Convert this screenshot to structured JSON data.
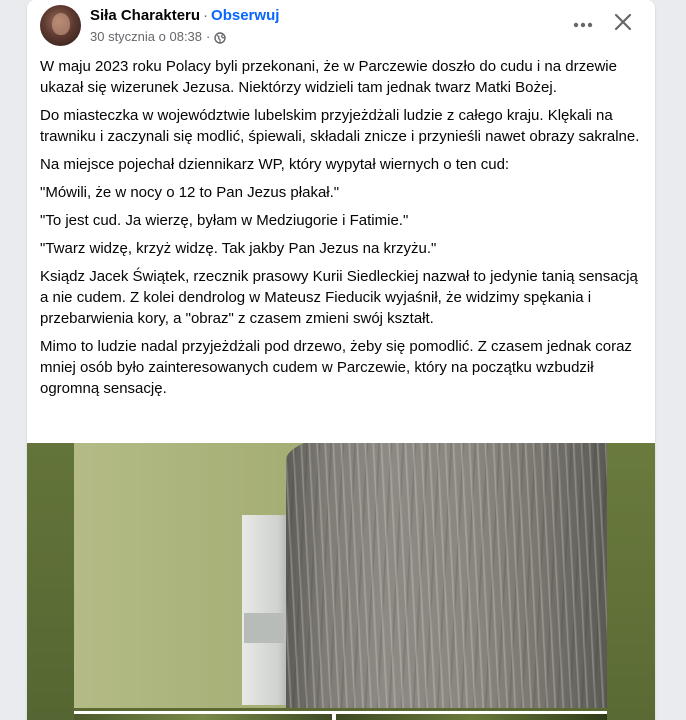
{
  "post": {
    "author": "Siła Charakteru",
    "separator": "·",
    "follow_label": "Obserwuj",
    "timestamp": "30 stycznia o 08:38",
    "timestamp_separator": "·",
    "privacy_icon": "globe-icon",
    "more_icon": "more-horizontal-icon",
    "close_icon": "close-icon",
    "paragraphs": [
      "W maju 2023 roku Polacy byli przekonani, że w Parczewie doszło do cudu i na drzewie ukazał się wizerunek Jezusa. Niektórzy widzieli tam jednak twarz Matki Bożej.",
      "Do miasteczka w województwie lubelskim przyjeżdżali ludzie z całego kraju. Klękali na trawniku i zaczynali się modlić, śpiewali, składali znicze i przynieśli nawet obrazy sakralne.",
      "Na miejsce pojechał dziennikarz WP, który wypytał wiernych o ten cud:",
      "\"Mówili, że w nocy o 12 to Pan Jezus płakał.\"",
      "\"To jest cud. Ja wierzę, byłam w Medziugorie i Fatimie.\"",
      "\"Twarz widzę, krzyż widzę. Tak jakby Pan Jezus na krzyżu.\"",
      "Ksiądz Jacek Świątek, rzecznik prasowy Kurii Siedleckiej nazwał to jedynie tanią sensacją a nie cudem. Z kolei dendrolog w Mateusz Fieducik wyjaśnił, że widzimy spękania i przebarwienia kory, a \"obraz\" z czasem zmieni swój kształt.",
      "Mimo to ludzie nadal przyjeżdżali pod drzewo, żeby się pomodlić. Z czasem jednak coraz mniej osób było zainteresowanych cudem w Parczewie, który na początku wzbudził ogromną sensację."
    ]
  },
  "colors": {
    "link_blue": "#0866ff",
    "text_primary": "#050505",
    "text_secondary": "#65676b",
    "page_background": "#e9ebee"
  }
}
